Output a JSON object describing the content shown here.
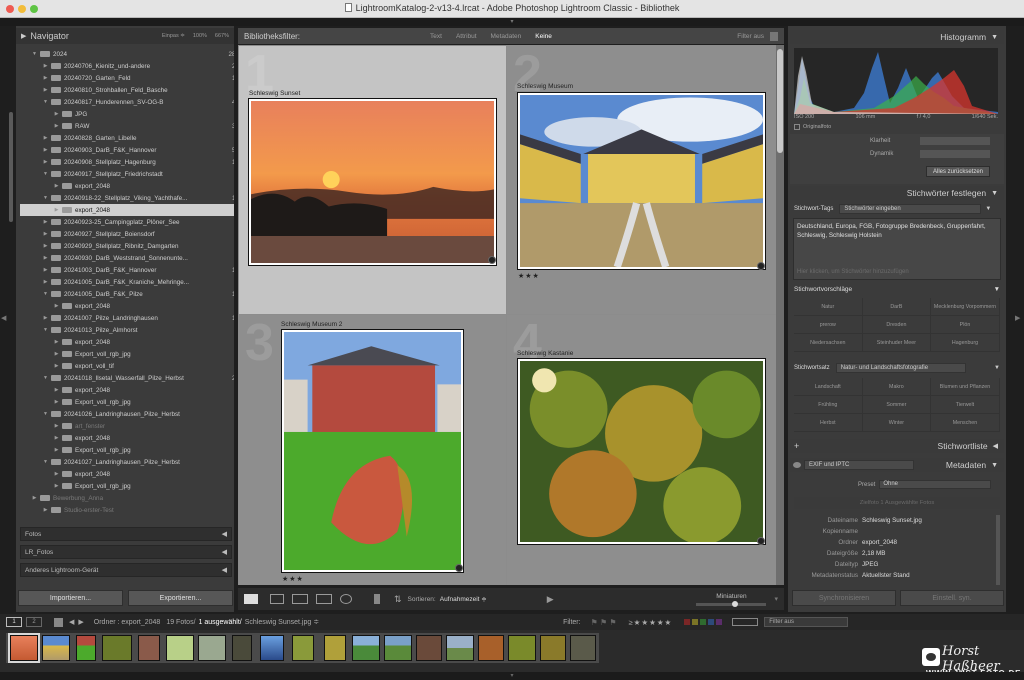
{
  "window": {
    "title": "LightroomKatalog-2-v13-4.lrcat - Adobe Photoshop Lightroom Classic - Bibliothek"
  },
  "navigator": {
    "title": "Navigator",
    "zoom_fit": "Einpas ≑",
    "zoom_100": "100%",
    "zoom_667": "667%"
  },
  "folders": [
    {
      "indent": 1,
      "open": true,
      "name": "2024",
      "count": "28864"
    },
    {
      "indent": 2,
      "open": false,
      "name": "20240706_Kienitz_und-andere",
      "count": "2074"
    },
    {
      "indent": 2,
      "open": false,
      "name": "20240720_Garten_Feld",
      "count": "1407"
    },
    {
      "indent": 2,
      "open": false,
      "name": "20240810_Strohballen_Feld_Basche",
      "count": "411"
    },
    {
      "indent": 2,
      "open": true,
      "name": "20240817_Hunderennen_SV-OG-B",
      "count": "4198"
    },
    {
      "indent": 3,
      "open": false,
      "name": "JPG",
      "count": "272"
    },
    {
      "indent": 3,
      "open": false,
      "name": "RAW",
      "count": "3901"
    },
    {
      "indent": 2,
      "open": false,
      "name": "20240828_Garten_Libelle",
      "count": "863"
    },
    {
      "indent": 2,
      "open": false,
      "name": "20240903_DarB_F&K_Hannover",
      "count": "5641"
    },
    {
      "indent": 2,
      "open": false,
      "name": "20240908_Stellplatz_Hagenburg",
      "count": "1906"
    },
    {
      "indent": 2,
      "open": true,
      "name": "20240917_Stellplatz_Friedrichstadt",
      "count": "281"
    },
    {
      "indent": 3,
      "open": false,
      "name": "export_2048",
      "count": "4"
    },
    {
      "indent": 2,
      "open": true,
      "name": "20240918-22_Stellplatz_Viking_Yachthafe...",
      "count": "1609"
    },
    {
      "indent": 3,
      "open": false,
      "name": "export_2048",
      "count": "19",
      "selected": true
    },
    {
      "indent": 2,
      "open": false,
      "name": "20240923-25_Campingplatz_Plöner_See",
      "count": "738"
    },
    {
      "indent": 2,
      "open": false,
      "name": "20240927_Stellplatz_Boiensdorf",
      "count": "27"
    },
    {
      "indent": 2,
      "open": false,
      "name": "20240929_Stellplatz_Ribnitz_Damgarten",
      "count": "343"
    },
    {
      "indent": 2,
      "open": false,
      "name": "20240930_DarB_Weststrand_Sonnenunte...",
      "count": "147"
    },
    {
      "indent": 2,
      "open": false,
      "name": "20241003_DarB_F&K_Hannover",
      "count": "1436"
    },
    {
      "indent": 2,
      "open": false,
      "name": "20241005_DarB_F&K_Kraniche_Mehringe...",
      "count": "808"
    },
    {
      "indent": 2,
      "open": true,
      "name": "20241005_DarB_F&K_Pilze",
      "count": "1824"
    },
    {
      "indent": 3,
      "open": false,
      "name": "export_2048",
      "count": "2"
    },
    {
      "indent": 2,
      "open": false,
      "name": "20241007_Pilze_Landringhausen",
      "count": "1478"
    },
    {
      "indent": 2,
      "open": true,
      "name": "20241013_Pilze_Almhorst",
      "count": "273"
    },
    {
      "indent": 3,
      "open": false,
      "name": "export_2048",
      "count": "5"
    },
    {
      "indent": 3,
      "open": false,
      "name": "Export_voll_rgb_jpg",
      "count": "7"
    },
    {
      "indent": 3,
      "open": false,
      "name": "export_voll_tif",
      "count": "2"
    },
    {
      "indent": 2,
      "open": true,
      "name": "20241018_Ilsetal_Wasserfall_Pilze_Herbst",
      "count": "2356"
    },
    {
      "indent": 3,
      "open": false,
      "name": "export_2048",
      "count": "4"
    },
    {
      "indent": 3,
      "open": false,
      "name": "Export_voll_rgb_jpg",
      "count": "3"
    },
    {
      "indent": 2,
      "open": true,
      "name": "20241026_Landringhausen_Pilze_Herbst",
      "count": "473"
    },
    {
      "indent": 3,
      "open": false,
      "name": "art_fenster",
      "count": "",
      "dim": true
    },
    {
      "indent": 3,
      "open": false,
      "name": "export_2048",
      "count": "2"
    },
    {
      "indent": 3,
      "open": false,
      "name": "Export_voll_rgb_jpg",
      "count": "1"
    },
    {
      "indent": 2,
      "open": true,
      "name": "20241027_Landringhausen_Pilze_Herbst",
      "count": "571"
    },
    {
      "indent": 3,
      "open": false,
      "name": "export_2048",
      "count": "2"
    },
    {
      "indent": 3,
      "open": false,
      "name": "Export_voll_rgb_jpg",
      "count": "1"
    },
    {
      "indent": 1,
      "open": false,
      "name": "Bewerbung_Anna",
      "count": "0",
      "dim": true
    },
    {
      "indent": 2,
      "open": false,
      "name": "Studio-erster-Test",
      "count": "0",
      "dim": true
    }
  ],
  "collections": [
    {
      "name": "Fotos",
      "arrow": "◀"
    },
    {
      "name": "LR_Fotos",
      "arrow": "◀"
    },
    {
      "name": "Anderes Lightroom-Gerät",
      "arrow": "◀"
    }
  ],
  "left_buttons": {
    "import": "Importieren...",
    "export": "Exportieren..."
  },
  "filter_bar": {
    "label": "Bibliotheksfilter:",
    "text": "Text",
    "attribute": "Attribut",
    "metadata": "Metadaten",
    "none": "Keine",
    "filter_off": "Filter aus"
  },
  "grid": [
    {
      "num": "1",
      "caption": "Schleswig Sunset",
      "stars": ""
    },
    {
      "num": "2",
      "caption": "Schleswig Museum",
      "stars": "★★★"
    },
    {
      "num": "3",
      "caption": "Schleswig Museum 2",
      "stars": "★★★"
    },
    {
      "num": "4",
      "caption": "Schleswig Kastanie",
      "stars": ""
    }
  ],
  "toolbar": {
    "sort_label": "Sortieren:",
    "sort_value": "Aufnahmezeit ≑",
    "thumbs_label": "Miniaturen"
  },
  "histogram": {
    "title": "Histogramm",
    "iso": "ISO 200",
    "focal": "106 mm",
    "aperture": "f / 4,0",
    "shutter": "1/640 Sek.",
    "original": "Originalfoto"
  },
  "quick_develop": {
    "clarity": "Klarheit",
    "vibrance": "Dynamik",
    "reset": "Alles zurücksetzen"
  },
  "keywording": {
    "title": "Stichwörter festlegen",
    "tags_label": "Stichwort-Tags",
    "tags_mode": "Stichwörter eingeben",
    "keywords_text": "Deutschland, Europa, FGB, Fotogruppe Bredenbeck, Gruppenfahrt, Schleswig, Schleswig Holstein",
    "placeholder": "Hier klicken, um Stichwörter hinzuzufügen",
    "suggestions_title": "Stichwortvorschläge",
    "suggestions": [
      "Natur",
      "DarB",
      "Mecklenburg Vorpommern",
      "prerow",
      "Dresden",
      "Plön",
      "Niedersachsen",
      "Steinhuder Meer",
      "Hagenburg"
    ],
    "set_label": "Stichwortsatz",
    "set_value": "Natur- und Landschaftsfotografie",
    "set_items": [
      "Landschaft",
      "Makro",
      "Blumen und Pflanzen",
      "Frühling",
      "Sommer",
      "Tierwelt",
      "Herbst",
      "Winter",
      "Menschen"
    ]
  },
  "keyword_list": {
    "title": "Stichwortliste",
    "plus": "+"
  },
  "metadata": {
    "title": "Metadaten",
    "preset_dropdown": "EXIF und IPTC",
    "preset_label": "Preset",
    "preset_value": "Ohne",
    "nav_text": "Zielfoto   1   Ausgewählte Fotos",
    "rows": [
      {
        "label": "Dateiname",
        "value": "Schleswig Sunset.jpg"
      },
      {
        "label": "Kopienname",
        "value": ""
      },
      {
        "label": "Ordner",
        "value": "export_2048"
      },
      {
        "label": "Dateigröße",
        "value": "2,18 MB"
      },
      {
        "label": "Dateityp",
        "value": "JPEG"
      },
      {
        "label": "Metadatenstatus",
        "value": "Aktuellster Stand"
      }
    ],
    "sync_meta": "Synchronisieren",
    "sync_settings": "Einstell. syn."
  },
  "statusbar": {
    "page1": "1",
    "page2": "2",
    "source": "Ordner : export_2048",
    "count": "19 Fotos/",
    "selected": "1 ausgewählt/",
    "file": "Schleswig Sunset.jpg ≑",
    "filter_label": "Filter:",
    "filter_value": "Filter aus"
  },
  "watermark": {
    "name": "Horst Haßheer",
    "site": "WWW.JUST-FOTO.DE"
  },
  "colors": {
    "accent_sel": "#cfcfcf",
    "panel": "#3f3f3f",
    "grid_bg": "#8e8e8e"
  }
}
